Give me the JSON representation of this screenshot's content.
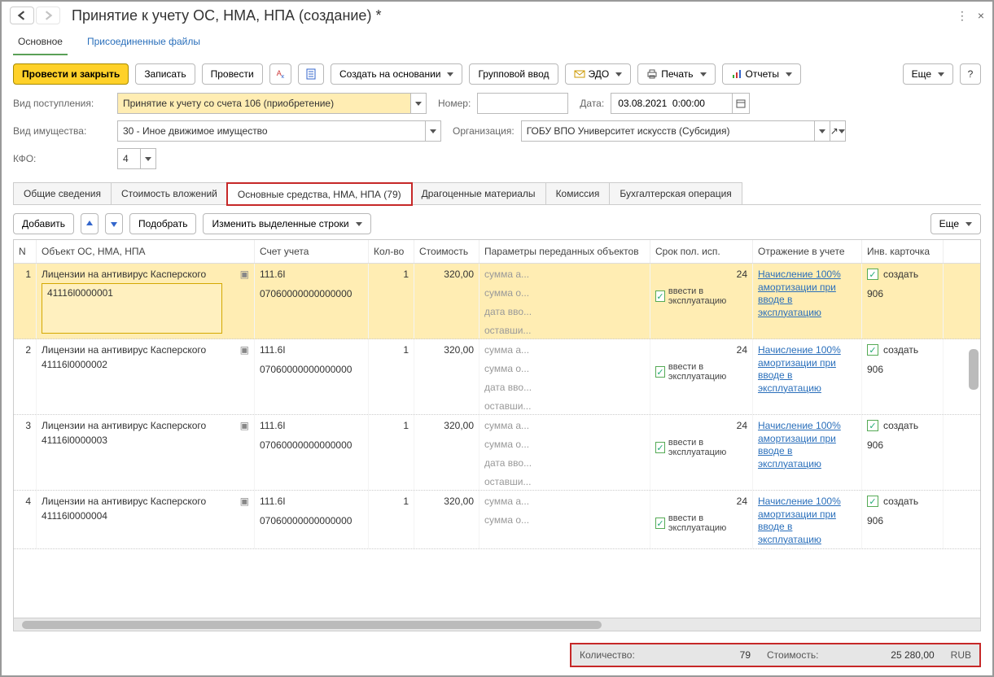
{
  "window": {
    "title": "Принятие к учету ОС, НМА, НПА (создание) *"
  },
  "nav_tabs": [
    {
      "label": "Основное",
      "active": true
    },
    {
      "label": "Присоединенные файлы",
      "active": false
    }
  ],
  "toolbar": {
    "post_and_close": "Провести и закрыть",
    "write": "Записать",
    "post": "Провести",
    "base_create": "Создать на основании",
    "group_input": "Групповой ввод",
    "edo": "ЭДО",
    "print": "Печать",
    "reports": "Отчеты",
    "more": "Еще",
    "help": "?"
  },
  "form": {
    "receipt_type_label": "Вид поступления:",
    "receipt_type_value": "Принятие к учету со счета 106 (приобретение)",
    "number_label": "Номер:",
    "number_value": "",
    "date_label": "Дата:",
    "date_value": "03.08.2021  0:00:00",
    "asset_type_label": "Вид имущества:",
    "asset_type_value": "30 - Иное движимое имущество",
    "org_label": "Организация:",
    "org_value": "ГОБУ ВПО Университет искусств (Субсидия)",
    "kfo_label": "КФО:",
    "kfo_value": "4"
  },
  "doc_tabs": [
    {
      "label": "Общие сведения"
    },
    {
      "label": "Стоимость вложений"
    },
    {
      "label": "Основные средства, НМА, НПА (79)",
      "active": true,
      "highlight": true
    },
    {
      "label": "Драгоценные материалы"
    },
    {
      "label": "Комиссия"
    },
    {
      "label": "Бухгалтерская операция"
    }
  ],
  "subtoolbar": {
    "add": "Добавить",
    "select": "Подобрать",
    "edit_rows": "Изменить выделенные строки",
    "more": "Еще"
  },
  "table": {
    "headers": {
      "n": "N",
      "object": "Объект ОС, НМА, НПА",
      "account": "Счет учета",
      "qty": "Кол-во",
      "cost": "Стоимость",
      "params": "Параметры переданных объектов",
      "service_life": "Срок пол. исп.",
      "accounting_reflection": "Отражение в учете",
      "inv_card": "Инв. карточка"
    },
    "param_rows": {
      "amort_sum": "сумма а...",
      "resid_sum": "сумма о...",
      "entry_date": "дата вво...",
      "remaining": "оставши..."
    },
    "in_use_label": "ввести в эксплуатацию",
    "accounting_link": "Начисление 100% амортизации при вводе в эксплуатацию",
    "inv_create_label": "создать",
    "rows": [
      {
        "n": "1",
        "object": "Лицензии на антивирус Касперского",
        "code": "41116l0000001",
        "acct1": "111.6I",
        "acct2": "07060000000000000",
        "qty": "1",
        "cost": "320,00",
        "life": "24",
        "inv_num": "906",
        "selected": true
      },
      {
        "n": "2",
        "object": "Лицензии на антивирус Касперского",
        "code": "41116l0000002",
        "acct1": "111.6I",
        "acct2": "07060000000000000",
        "qty": "1",
        "cost": "320,00",
        "life": "24",
        "inv_num": "906"
      },
      {
        "n": "3",
        "object": "Лицензии на антивирус Касперского",
        "code": "41116l0000003",
        "acct1": "111.6I",
        "acct2": "07060000000000000",
        "qty": "1",
        "cost": "320,00",
        "life": "24",
        "inv_num": "906"
      },
      {
        "n": "4",
        "object": "Лицензии на антивирус Касперского",
        "code": "41116l0000004",
        "acct1": "111.6I",
        "acct2": "07060000000000000",
        "qty": "1",
        "cost": "320,00",
        "life": "24",
        "inv_num": "906"
      }
    ]
  },
  "footer": {
    "qty_label": "Количество:",
    "qty_value": "79",
    "cost_label": "Стоимость:",
    "cost_value": "25 280,00",
    "currency": "RUB"
  }
}
